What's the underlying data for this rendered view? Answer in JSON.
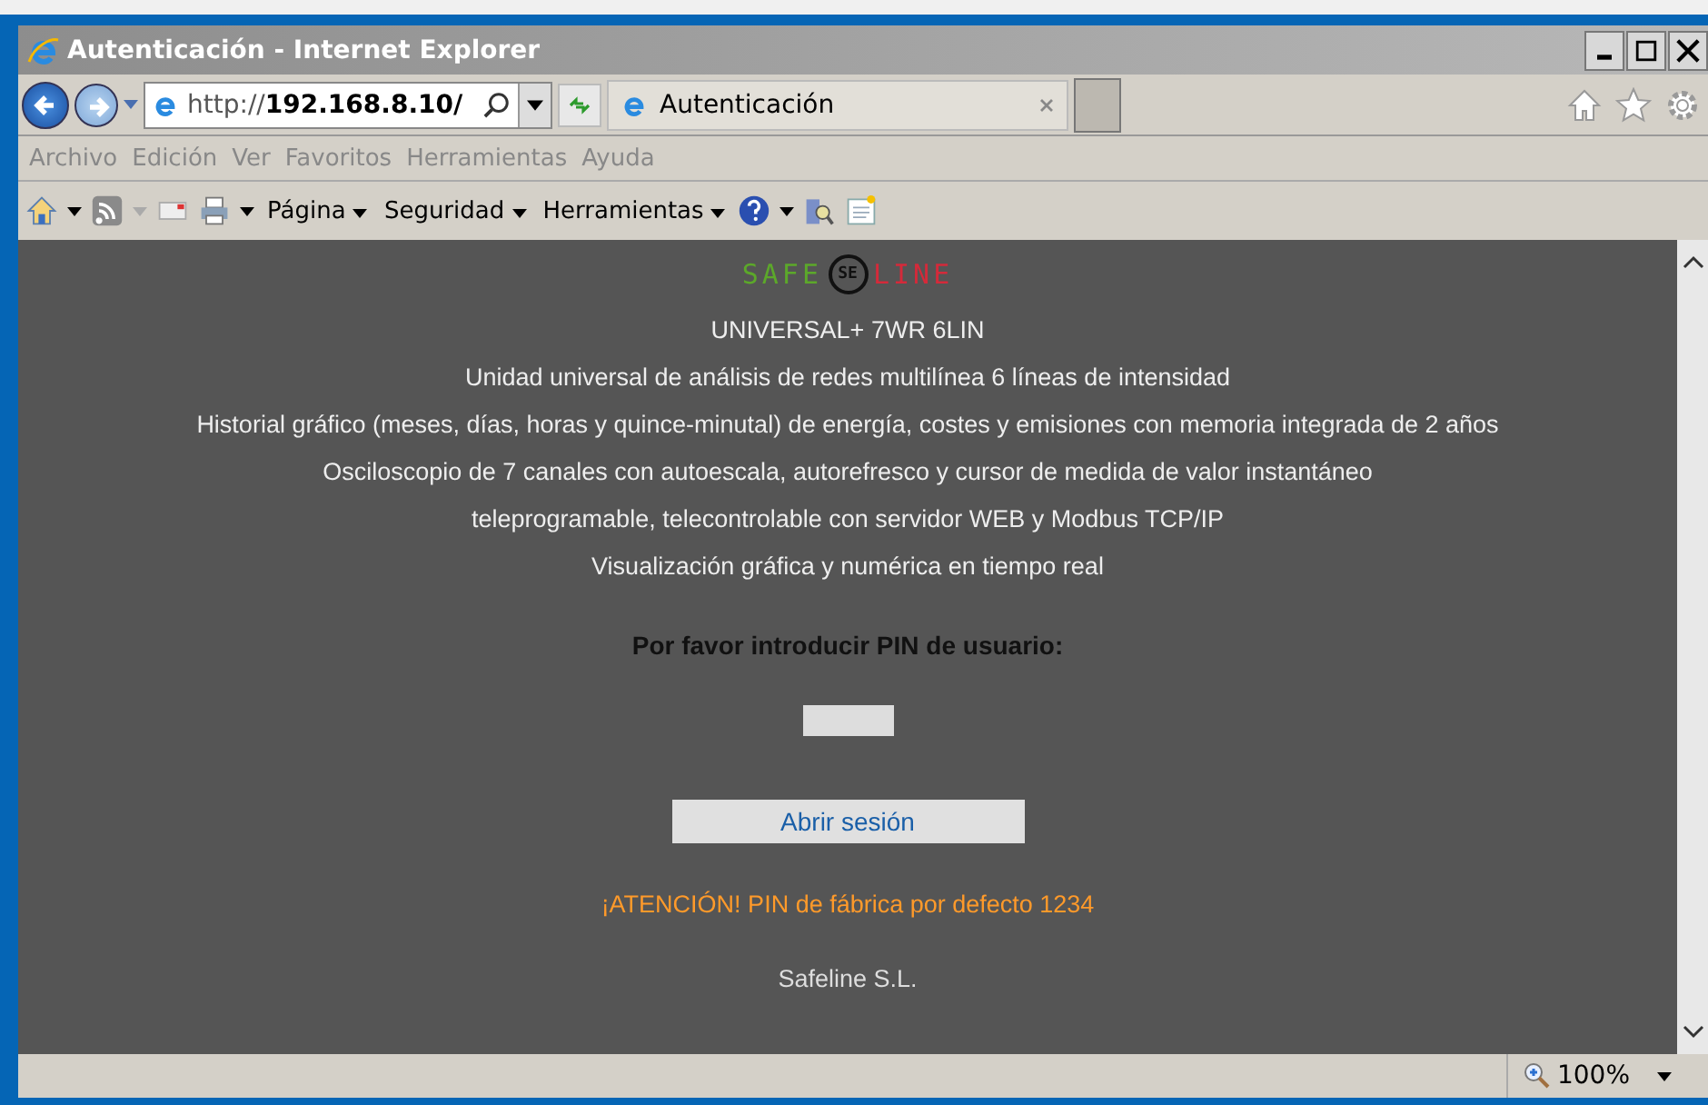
{
  "window": {
    "title": "Autenticación - Internet Explorer"
  },
  "address_bar": {
    "url_prefix": "http://",
    "url_host": "192.168.8.10/"
  },
  "tabs": [
    {
      "label": "Autenticación",
      "selected": true
    }
  ],
  "menu": [
    "Archivo",
    "Edición",
    "Ver",
    "Favoritos",
    "Herramientas",
    "Ayuda"
  ],
  "command_bar": [
    "Página",
    "Seguridad",
    "Herramientas"
  ],
  "page": {
    "logo": {
      "left": "SAFE",
      "right": "LINE",
      "mark": "SE"
    },
    "lines": [
      "UNIVERSAL+ 7WR 6LIN",
      "Unidad universal de análisis de redes multilínea 6 líneas de intensidad",
      "Historial gráfico (meses, días, horas y quince-minutal) de energía, costes y emisiones con memoria integrada de 2 años",
      "Osciloscopio de 7 canales con autoescala, autorefresco y cursor de medida de valor instantáneo",
      "teleprogramable, telecontrolable con servidor WEB y Modbus TCP/IP",
      "Visualización gráfica y numérica en tiempo real"
    ],
    "pin_label": "Por favor introducir PIN de usuario:",
    "login_button": "Abrir sesión",
    "warning": "¡ATENCIÓN! PIN de fábrica por defecto 1234",
    "footer": "Safeline S.L."
  },
  "status_bar": {
    "zoom": "100%"
  }
}
